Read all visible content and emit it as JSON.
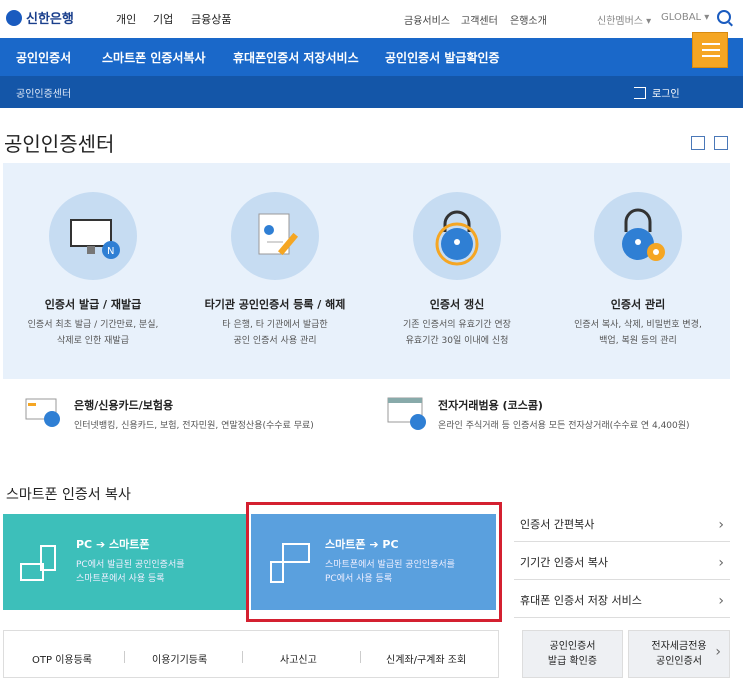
{
  "header": {
    "logo_text": "신한은행",
    "nav": [
      "개인",
      "기업",
      "금융상품"
    ],
    "utility": [
      "금융서비스",
      "고객센터",
      "은행소개"
    ],
    "family_site": "신한멤버스 ▾",
    "global": "GLOBAL ▾"
  },
  "main_nav": [
    "공인인증서",
    "스마트폰 인증서복사",
    "휴대폰인증서 저장서비스",
    "공인인증서 발급확인증"
  ],
  "subnav": {
    "crumb": "공인인증센터",
    "login": "로그인"
  },
  "page_title": "공인인증센터",
  "services": [
    {
      "title": "인증서 발급 / 재발급",
      "desc1": "인증서 최초 발급 / 기간만료, 분실,",
      "desc2": "삭제로 인한 재발급",
      "icon": "monitor-cert-icon"
    },
    {
      "title": "타기관 공인인증서 등록 / 해제",
      "desc1": "타 은행, 타 기관에서 발급한",
      "desc2": "공인 인증서 사용 관리",
      "icon": "document-pen-icon"
    },
    {
      "title": "인증서 갱신",
      "desc1": "기존 인증서의 유효기간 연장",
      "desc2": "유효기간 30일 이내에 신청",
      "icon": "lock-refresh-icon"
    },
    {
      "title": "인증서 관리",
      "desc1": "인증서 복사, 삭제, 비밀번호 변경,",
      "desc2": "백업, 복원 등의 관리",
      "icon": "lock-gear-icon"
    }
  ],
  "subservices": [
    {
      "title": "은행/신용카드/보험용",
      "desc": "인터넷뱅킹, 신용카드, 보험, 전자민원, 연말정산용(수수료 무료)"
    },
    {
      "title": "전자거래범용 (코스콤)",
      "desc": "온라인 주식거래 등 인증서용 모든 전자상거래(수수료 연 4,400원)"
    }
  ],
  "smartphone": {
    "title": "스마트폰 인증서 복사",
    "card1": {
      "title_from": "PC",
      "title_to": "스마트폰",
      "arrow": "➔",
      "desc1": "PC에서 발급된 공인인증서를",
      "desc2": "스마트폰에서 사용 등록"
    },
    "card2": {
      "title_from": "스마트폰",
      "title_to": "PC",
      "arrow": "➔",
      "desc1": "스마트폰에서 발급된 공인인증서를",
      "desc2": "PC에서 사용 등록"
    }
  },
  "right_links": [
    "인증서 간편복사",
    "기기간 인증서 복사",
    "휴대폰 인증서 저장 서비스"
  ],
  "bottom_links": [
    "OTP 이용등록",
    "이용기기등록",
    "사고신고",
    "신계좌/구계좌 조회"
  ],
  "bottom_cards": [
    {
      "line1": "공인인증서",
      "line2": "발급 확인증"
    },
    {
      "line1": "전자세금전용",
      "line2": "공인인증서"
    }
  ],
  "colors": {
    "nav_blue": "#1a68c9",
    "subnav_blue": "#1456a8",
    "accent_orange": "#f5a623",
    "teal": "#3dbfba",
    "card_blue": "#5aa0de",
    "highlight_red": "#d42030"
  }
}
